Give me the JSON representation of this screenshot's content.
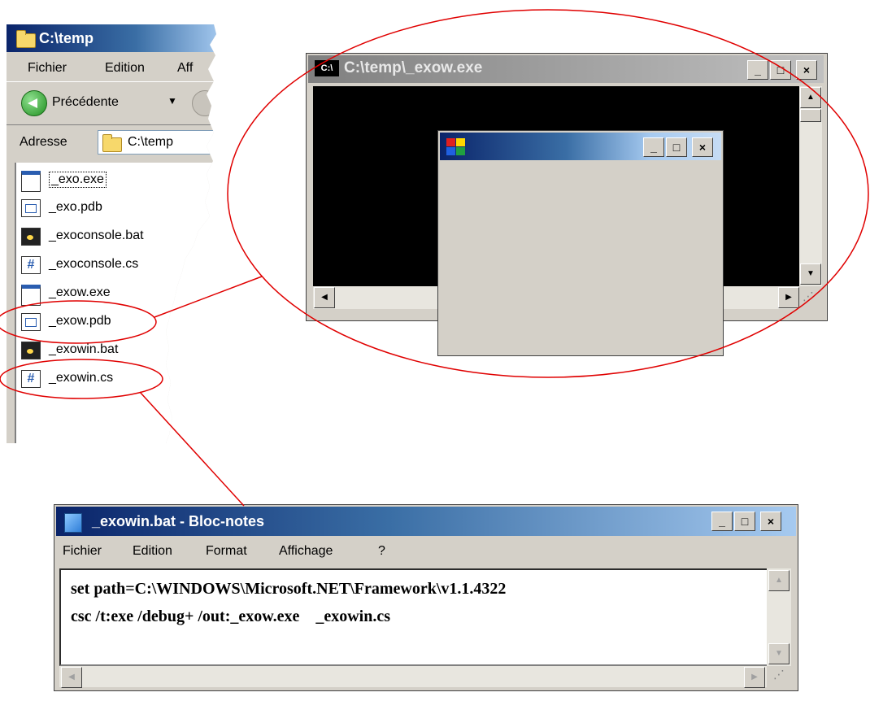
{
  "explorer": {
    "title": "C:\\temp",
    "menu": [
      "Fichier",
      "Edition",
      "Aff"
    ],
    "back_label": "Précédente",
    "address_label": "Adresse",
    "address_value": "C:\\temp",
    "files": [
      {
        "name": "_exo.exe",
        "icon": "exe-icon"
      },
      {
        "name": "_exo.pdb",
        "icon": "pdb-icon"
      },
      {
        "name": "_exoconsole.bat",
        "icon": "bat-icon"
      },
      {
        "name": "_exoconsole.cs",
        "icon": "cs-icon"
      },
      {
        "name": "_exow.exe",
        "icon": "exe-icon"
      },
      {
        "name": "_exow.pdb",
        "icon": "pdb-icon"
      },
      {
        "name": "_exowin.bat",
        "icon": "bat-icon"
      },
      {
        "name": "_exowin.cs",
        "icon": "cs-icon"
      }
    ]
  },
  "console": {
    "title": "C:\\temp\\_exow.exe",
    "icon_text": "C:\\"
  },
  "notepad": {
    "title": "_exowin.bat - Bloc-notes",
    "menu": [
      "Fichier",
      "Edition",
      "Format",
      "Affichage",
      "?"
    ],
    "lines": [
      "set path=C:\\WINDOWS\\Microsoft.NET\\Framework\\v1.1.4322",
      "csc /t:exe /debug+ /out:_exow.exe    _exowin.cs"
    ]
  },
  "caption_buttons": {
    "minimize": "_",
    "maximize": "□",
    "close": "×"
  },
  "colors": {
    "annotation": "#e00000",
    "title_active": "#0a246a",
    "title_inactive": "#808080"
  }
}
